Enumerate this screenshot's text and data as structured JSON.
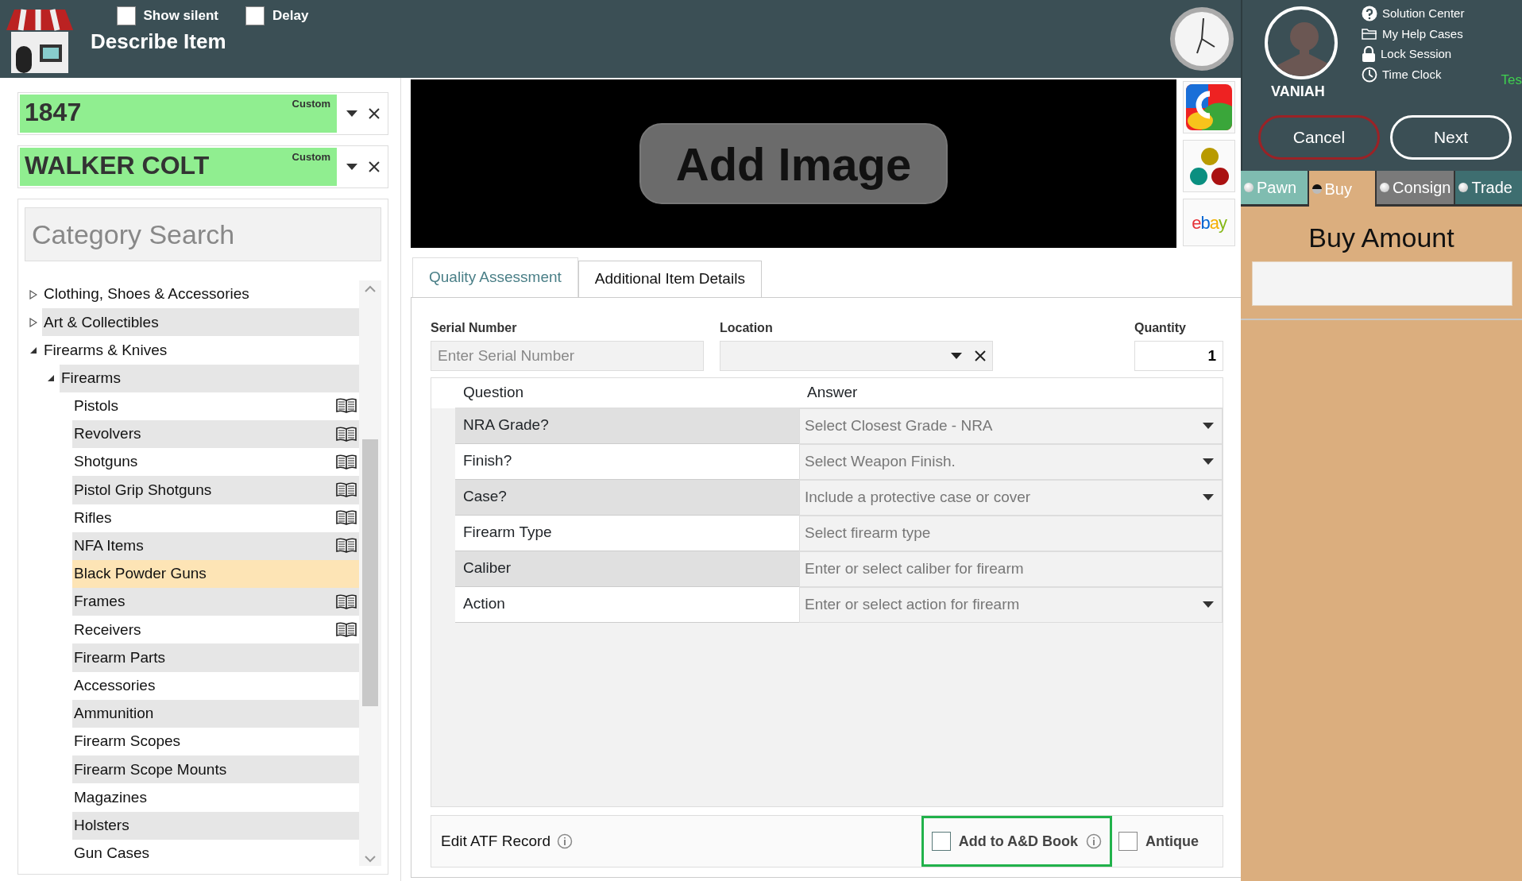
{
  "header": {
    "title": "Describe Item",
    "toggles": [
      {
        "label": "Show silent",
        "checked": false
      },
      {
        "label": "Delay",
        "checked": false
      }
    ]
  },
  "user": {
    "name": "VANIAH",
    "links": [
      "Solution Center",
      "My Help Cases",
      "Lock Session",
      "Time Clock"
    ]
  },
  "environment_tag": "Tes",
  "actions": [
    {
      "label": "Cancel",
      "kind": "cancel"
    },
    {
      "label": "Next",
      "kind": "primary"
    }
  ],
  "modes": [
    {
      "label": "Pawn",
      "selected": false,
      "color": "#7fbcb0"
    },
    {
      "label": "Buy",
      "selected": true,
      "color": "#dbae7e"
    },
    {
      "label": "Consign",
      "selected": false,
      "color": "#7a7a7a"
    },
    {
      "label": "Trade",
      "selected": false,
      "color": "#3e6e70"
    }
  ],
  "amount": {
    "label": "Buy Amount"
  },
  "item_fields": [
    {
      "value": "1847",
      "badge": "Custom"
    },
    {
      "value": "WALKER COLT",
      "badge": "Custom"
    }
  ],
  "category_search": {
    "placeholder": "Category Search"
  },
  "categories": [
    {
      "label": "Clothing, Shoes & Accessories",
      "expanded": false
    },
    {
      "label": "Art & Collectibles",
      "expanded": false
    },
    {
      "label": "Firearms & Knives",
      "expanded": true,
      "children": [
        {
          "label": "Firearms",
          "expanded": true,
          "children": [
            {
              "label": "Pistols",
              "book": true,
              "selected": false
            },
            {
              "label": "Revolvers",
              "book": true,
              "selected": false
            },
            {
              "label": "Shotguns",
              "book": true,
              "selected": false
            },
            {
              "label": "Pistol Grip Shotguns",
              "book": true,
              "selected": false
            },
            {
              "label": "Rifles",
              "book": true,
              "selected": false
            },
            {
              "label": "NFA Items",
              "book": true,
              "selected": false
            },
            {
              "label": "Black Powder Guns",
              "book": false,
              "selected": true
            },
            {
              "label": "Frames",
              "book": true,
              "selected": false
            },
            {
              "label": "Receivers",
              "book": true,
              "selected": false
            },
            {
              "label": "Firearm Parts",
              "book": false,
              "selected": false
            },
            {
              "label": "Accessories",
              "book": false,
              "selected": false
            },
            {
              "label": "Ammunition",
              "book": false,
              "selected": false
            },
            {
              "label": "Firearm Scopes",
              "book": false,
              "selected": false
            },
            {
              "label": "Firearm Scope Mounts",
              "book": false,
              "selected": false
            },
            {
              "label": "Magazines",
              "book": false,
              "selected": false
            },
            {
              "label": "Holsters",
              "book": false,
              "selected": false
            },
            {
              "label": "Gun Cases",
              "book": false,
              "selected": false
            }
          ]
        }
      ]
    }
  ],
  "image_panel": {
    "button": "Add Image"
  },
  "lookup_buttons": [
    {
      "kind": "google"
    },
    {
      "kind": "dots"
    },
    {
      "kind": "ebay",
      "label": "ebay"
    }
  ],
  "detail_tabs": [
    {
      "label": "Quality Assessment",
      "selected": true
    },
    {
      "label": "Additional Item Details",
      "selected": false
    }
  ],
  "fields": {
    "serial": {
      "label": "Serial Number",
      "placeholder": "Enter Serial Number"
    },
    "location": {
      "label": "Location"
    },
    "quantity": {
      "label": "Quantity",
      "value": "1"
    }
  },
  "questions": {
    "columns": [
      "Question",
      "Answer"
    ],
    "rows": [
      {
        "question": "NRA Grade?",
        "placeholder": "Select Closest Grade - NRA",
        "dropdown": true
      },
      {
        "question": "Finish?",
        "placeholder": "Select Weapon Finish.",
        "dropdown": true
      },
      {
        "question": "Case?",
        "placeholder": "Include a protective case or cover",
        "dropdown": true
      },
      {
        "question": "Firearm Type",
        "placeholder": "Select firearm type",
        "dropdown": false
      },
      {
        "question": "Caliber",
        "placeholder": "Enter or select caliber for firearm",
        "dropdown": false
      },
      {
        "question": "Action",
        "placeholder": "Enter or select action for firearm",
        "dropdown": true
      }
    ]
  },
  "footer": {
    "atf": {
      "label": "Edit ATF Record"
    },
    "ad_book": {
      "label": "Add to A&D Book",
      "checked": false,
      "highlighted": true
    },
    "antique": {
      "label": "Antique",
      "checked": false
    }
  }
}
